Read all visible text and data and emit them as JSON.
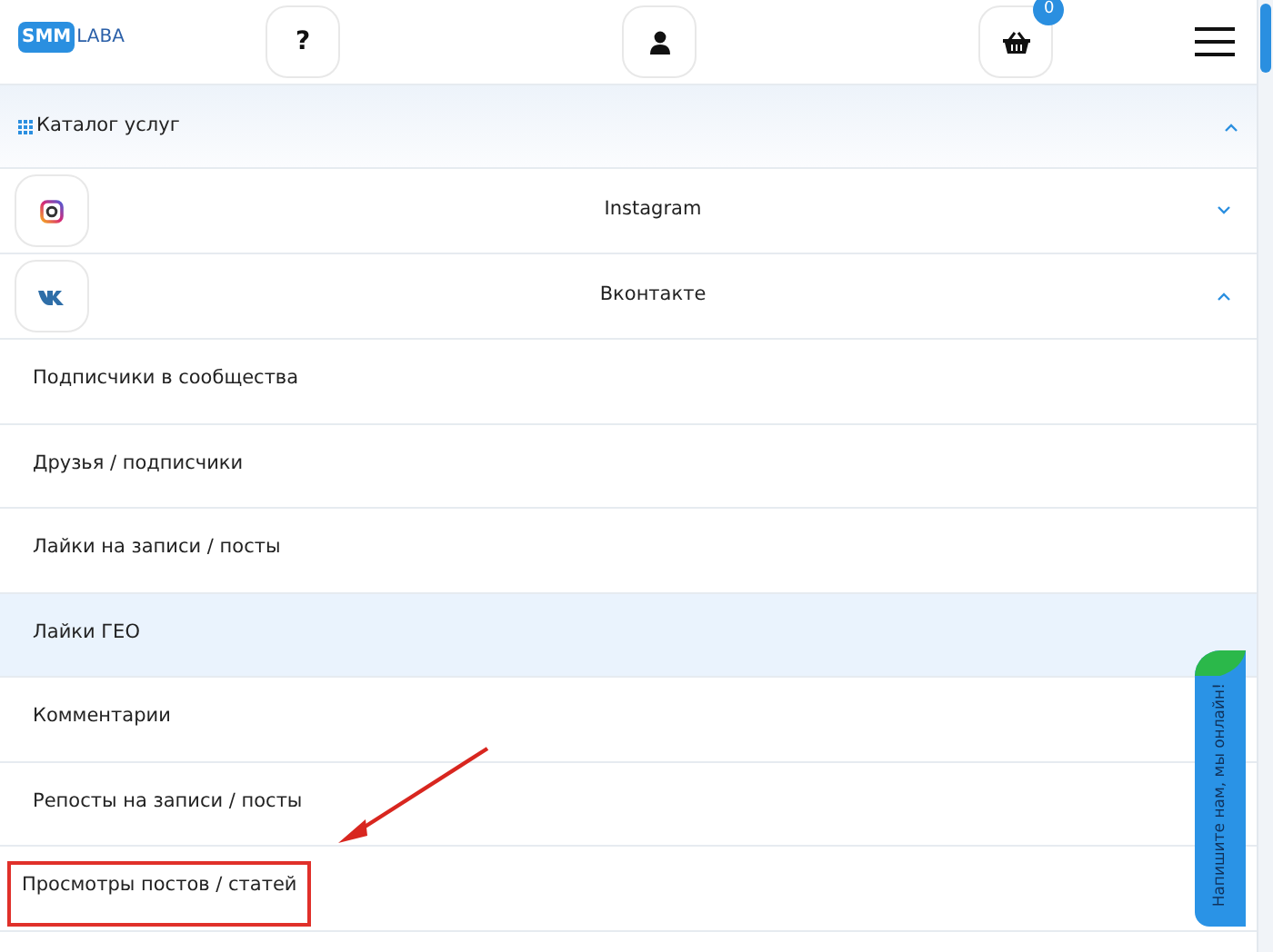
{
  "header": {
    "logo": {
      "mark": "SMM",
      "word": "LABA"
    },
    "help_button": "?",
    "cart_count": "0"
  },
  "catalog": {
    "title": "Каталог услуг",
    "expanded": true
  },
  "networks": [
    {
      "kind": "instagram",
      "name": "Instagram",
      "expanded": false
    },
    {
      "kind": "vk",
      "name": "Вконтакте",
      "expanded": true
    }
  ],
  "services": [
    {
      "label": "Подписчики в сообщества",
      "selected": false,
      "highlighted": false
    },
    {
      "label": "Друзья / подписчики",
      "selected": false,
      "highlighted": false
    },
    {
      "label": "Лайки на записи / посты",
      "selected": false,
      "highlighted": false
    },
    {
      "label": "Лайки ГЕО",
      "selected": true,
      "highlighted": false
    },
    {
      "label": "Комментарии",
      "selected": false,
      "highlighted": false
    },
    {
      "label": "Репосты на записи / посты",
      "selected": false,
      "highlighted": false
    },
    {
      "label": "Просмотры постов / статей",
      "selected": false,
      "highlighted": true
    }
  ],
  "chat_tab": "Напишите нам, мы онлайн!"
}
